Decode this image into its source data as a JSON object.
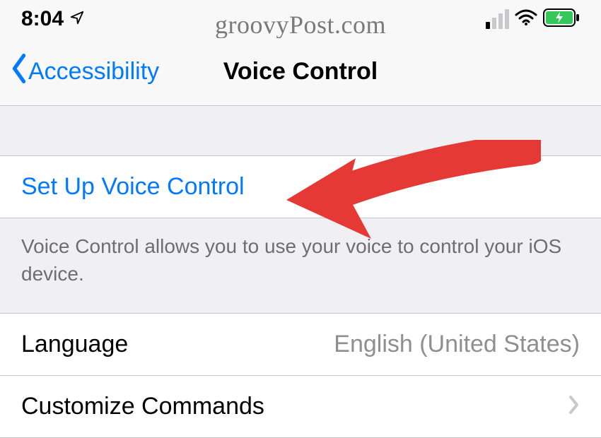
{
  "statusBar": {
    "time": "8:04",
    "watermark": "groovyPost.com"
  },
  "nav": {
    "back": "Accessibility",
    "title": "Voice Control"
  },
  "setup": {
    "label": "Set Up Voice Control",
    "footer": "Voice Control allows you to use your voice to control your iOS device."
  },
  "language": {
    "label": "Language",
    "value": "English (United States)"
  },
  "customize": {
    "label": "Customize Commands"
  }
}
